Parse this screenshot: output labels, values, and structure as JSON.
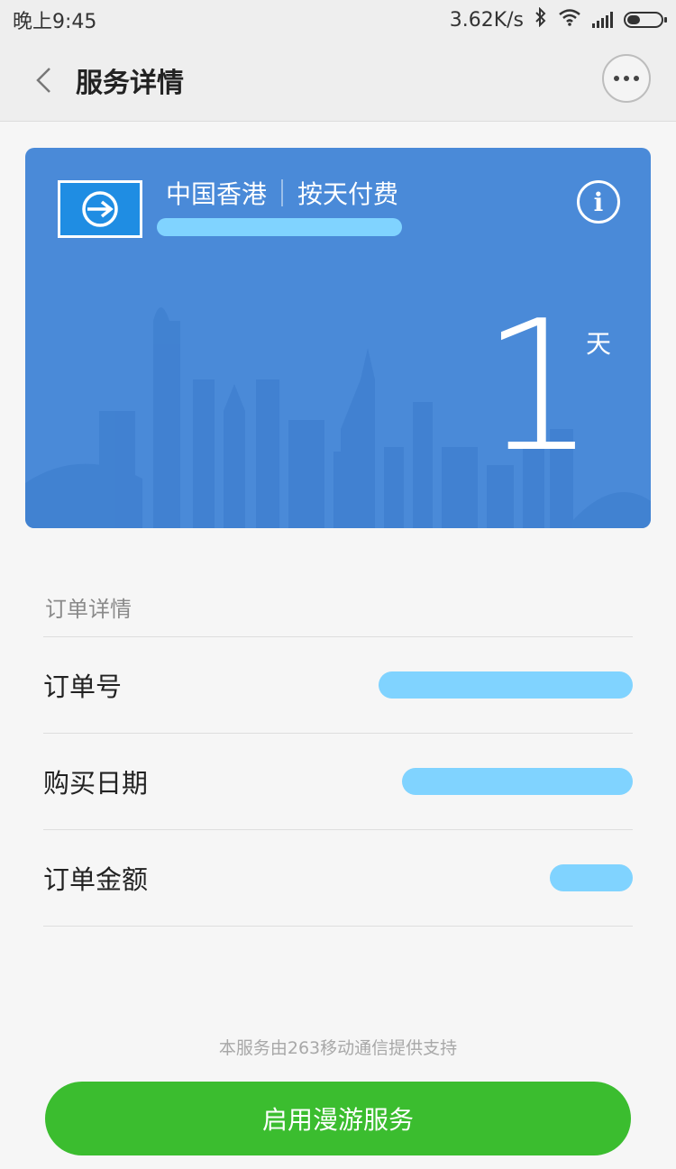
{
  "status_bar": {
    "time": "晚上9:45",
    "network_speed": "3.62K/s",
    "icons": [
      "bluetooth-icon",
      "wifi-icon",
      "signal-icon",
      "battery-icon"
    ]
  },
  "header": {
    "title": "服务详情",
    "back_icon": "chevron-left-icon",
    "more_icon": "more-dots-icon"
  },
  "card": {
    "region": "中国香港",
    "billing": "按天付费",
    "days_value": "1",
    "days_unit": "天",
    "background_color": "#4a8ad8",
    "logo_icon": "airplane-logo-icon",
    "info_icon": "info-icon",
    "info_symbol": "i"
  },
  "order_details": {
    "section_title": "订单详情",
    "rows": [
      {
        "label": "订单号"
      },
      {
        "label": "购买日期"
      },
      {
        "label": "订单金额"
      }
    ]
  },
  "footer": {
    "note": "本服务由263移动通信提供支持",
    "button_label": "启用漫游服务",
    "button_color": "#3bbd2f"
  }
}
